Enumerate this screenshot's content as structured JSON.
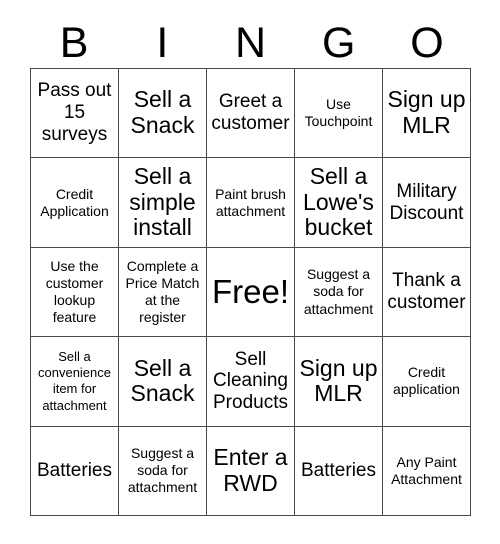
{
  "card": {
    "title": "BINGO",
    "free_space_label": "Free!",
    "colors": {
      "background": "#ffffff",
      "text": "#000000",
      "grid_line": "#4a4a4a"
    }
  },
  "header": {
    "letters": [
      "B",
      "I",
      "N",
      "G",
      "O"
    ]
  },
  "grid": {
    "rows": 5,
    "columns": 5,
    "cells": [
      [
        {
          "text": "Pass out 15 surveys",
          "size": "md"
        },
        {
          "text": "Sell a Snack",
          "size": "lg"
        },
        {
          "text": "Greet a customer",
          "size": "md"
        },
        {
          "text": "Use Touchpoint",
          "size": "sm"
        },
        {
          "text": "Sign up MLR",
          "size": "lg"
        }
      ],
      [
        {
          "text": "Credit Application",
          "size": "sm"
        },
        {
          "text": "Sell a simple install",
          "size": "lg"
        },
        {
          "text": "Paint brush attachment",
          "size": "sm"
        },
        {
          "text": "Sell a Lowe's bucket",
          "size": "lg"
        },
        {
          "text": "Military Discount",
          "size": "md"
        }
      ],
      [
        {
          "text": "Use the customer lookup feature",
          "size": "sm"
        },
        {
          "text": "Complete a Price Match at the register",
          "size": "sm"
        },
        {
          "text": "Free!",
          "size": "xl"
        },
        {
          "text": "Suggest a soda for attachment",
          "size": "sm"
        },
        {
          "text": "Thank a customer",
          "size": "md"
        }
      ],
      [
        {
          "text": "Sell a convenience item for attachment",
          "size": "xs"
        },
        {
          "text": "Sell a Snack",
          "size": "lg"
        },
        {
          "text": "Sell Cleaning Products",
          "size": "md"
        },
        {
          "text": "Sign up MLR",
          "size": "lg"
        },
        {
          "text": "Credit application",
          "size": "sm"
        }
      ],
      [
        {
          "text": "Batteries",
          "size": "md"
        },
        {
          "text": "Suggest a soda for attachment",
          "size": "sm"
        },
        {
          "text": "Enter a RWD",
          "size": "lg"
        },
        {
          "text": "Batteries",
          "size": "md"
        },
        {
          "text": "Any Paint Attachment",
          "size": "sm"
        }
      ]
    ]
  }
}
